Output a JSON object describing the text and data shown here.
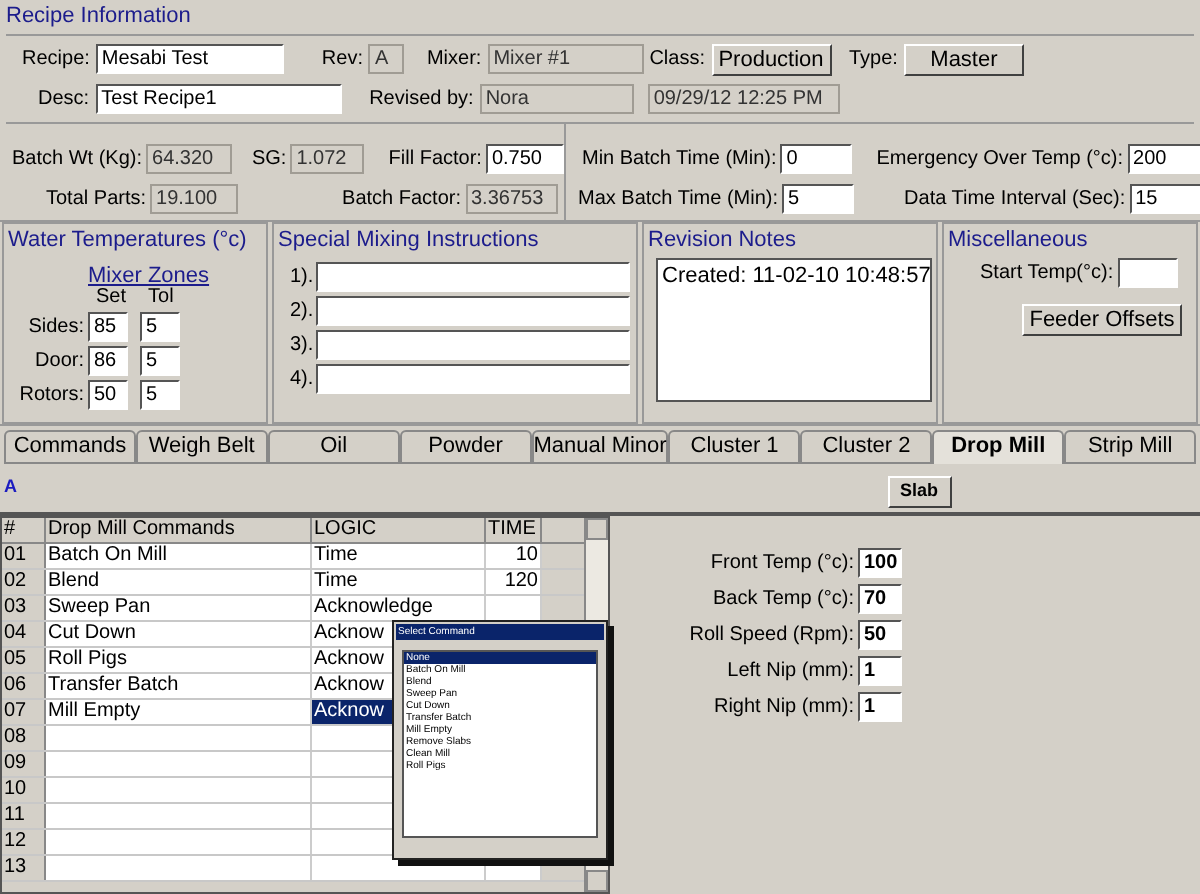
{
  "recipe_information": {
    "title": "Recipe Information",
    "recipe": {
      "label": "Recipe:",
      "value": "Mesabi Test"
    },
    "rev": {
      "label": "Rev:",
      "value": "A"
    },
    "mixer": {
      "label": "Mixer:",
      "value": "Mixer #1"
    },
    "class": {
      "label": "Class:",
      "button": "Production"
    },
    "type": {
      "label": "Type:",
      "button": "Master"
    },
    "desc": {
      "label": "Desc:",
      "value": "Test Recipe1"
    },
    "revised_by": {
      "label": "Revised by:",
      "value": "Nora"
    },
    "revised_date": "09/29/12 12:25 PM",
    "batch_wt": {
      "label": "Batch Wt (Kg):",
      "value": "64.320"
    },
    "sg": {
      "label": "SG:",
      "value": "1.072"
    },
    "fill_factor": {
      "label": "Fill Factor:",
      "value": "0.750"
    },
    "total_parts": {
      "label": "Total Parts:",
      "value": "19.100"
    },
    "batch_factor": {
      "label": "Batch Factor:",
      "value": "3.36753"
    },
    "min_batch_time": {
      "label": "Min Batch Time (Min):",
      "value": "0"
    },
    "max_batch_time": {
      "label": "Max Batch Time (Min):",
      "value": "5"
    },
    "emergency_over_temp": {
      "label": "Emergency Over Temp (°c):",
      "value": "200"
    },
    "data_time_interval": {
      "label": "Data Time Interval (Sec):",
      "value": "15"
    }
  },
  "water_temperatures": {
    "title": "Water Temperatures (°c)",
    "zones_link": "Mixer Zones",
    "set_header": "Set",
    "tol_header": "Tol",
    "zones": [
      {
        "label": "Sides:",
        "set": "85",
        "tol": "5"
      },
      {
        "label": "Door:",
        "set": "86",
        "tol": "5"
      },
      {
        "label": "Rotors:",
        "set": "50",
        "tol": "5"
      }
    ]
  },
  "special_mixing_instructions": {
    "title": "Special Mixing Instructions",
    "lines": [
      "1).",
      "2).",
      "3).",
      "4)."
    ]
  },
  "revision_notes": {
    "title": "Revision Notes",
    "text": "Created: 11-02-10 10:48:57"
  },
  "miscellaneous": {
    "title": "Miscellaneous",
    "start_temp_label": "Start Temp(°c):",
    "feeder_offsets_button": "Feeder Offsets"
  },
  "tabs": [
    {
      "label": "Commands",
      "selected": false
    },
    {
      "label": "Weigh Belt",
      "selected": false
    },
    {
      "label": "Oil",
      "selected": false
    },
    {
      "label": "Powder",
      "selected": false
    },
    {
      "label": "Manual Minor",
      "selected": false
    },
    {
      "label": "Cluster 1",
      "selected": false
    },
    {
      "label": "Cluster 2",
      "selected": false
    },
    {
      "label": "Drop Mill",
      "selected": true
    },
    {
      "label": "Strip Mill",
      "selected": false
    }
  ],
  "toolbar": {
    "marker": "A",
    "slab_button": "Slab"
  },
  "commands_table": {
    "columns": [
      "#",
      "Drop Mill Commands",
      "LOGIC",
      "TIME"
    ],
    "rows": [
      {
        "num": "01",
        "command": "Batch On Mill",
        "logic": "Time",
        "time": "10",
        "selected": false
      },
      {
        "num": "02",
        "command": "Blend",
        "logic": "Time",
        "time": "120",
        "selected": false
      },
      {
        "num": "03",
        "command": "Sweep Pan",
        "logic": "Acknowledge",
        "selected": false
      },
      {
        "num": "04",
        "command": "Cut Down",
        "logic": "Acknow",
        "selected": false
      },
      {
        "num": "05",
        "command": "Roll Pigs",
        "logic": "Acknow",
        "selected": false
      },
      {
        "num": "06",
        "command": "Transfer Batch",
        "logic": "Acknow",
        "selected": false
      },
      {
        "num": "07",
        "command": "Mill Empty",
        "logic": "Acknow",
        "selected": true
      },
      {
        "num": "08"
      },
      {
        "num": "09"
      },
      {
        "num": "10"
      },
      {
        "num": "11"
      },
      {
        "num": "12"
      },
      {
        "num": "13"
      }
    ]
  },
  "select_command_popup": {
    "title": "Select Command",
    "items": [
      {
        "label": "None",
        "selected": true
      },
      {
        "label": "Batch On Mill",
        "selected": false
      },
      {
        "label": "Blend",
        "selected": false
      },
      {
        "label": "Sweep Pan",
        "selected": false
      },
      {
        "label": "Cut Down",
        "selected": false
      },
      {
        "label": "Transfer Batch",
        "selected": false
      },
      {
        "label": "Mill Empty",
        "selected": false
      },
      {
        "label": "Remove Slabs",
        "selected": false
      },
      {
        "label": "Clean Mill",
        "selected": false
      },
      {
        "label": "Roll Pigs",
        "selected": false
      }
    ]
  },
  "mill_settings": [
    {
      "label": "Front Temp (°c):",
      "value": "100"
    },
    {
      "label": "Back Temp (°c):",
      "value": "70"
    },
    {
      "label": "Roll Speed (Rpm):",
      "value": "50"
    },
    {
      "label": "Left Nip (mm):",
      "value": "1"
    },
    {
      "label": "Right Nip (mm):",
      "value": "1"
    }
  ]
}
